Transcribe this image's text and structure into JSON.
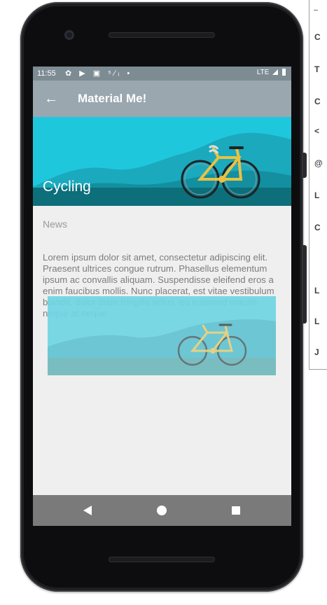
{
  "status_bar": {
    "time": "11:55",
    "icons": "✿ ▶ ▣ ⁵⁄ᵢ •",
    "network": "LTE"
  },
  "app_bar": {
    "back_icon": "←",
    "title": "Material Me!"
  },
  "detail": {
    "image_title": "Cycling",
    "subtitle": "News",
    "body": "Lorem ipsum dolor sit amet, consectetur adipiscing elit. Praesent ultrices congue rutrum. Phasellus elementum ipsum ac convallis aliquam. Suspendisse eleifend eros a enim faucibus mollis. Nunc placerat, est vitae vestibulum blandit, dolor diam fringilla tellus, eu euismod mauris neque at neque."
  },
  "nav_bar": {
    "back_icon": "back-triangle-icon",
    "home_icon": "home-circle-icon",
    "recent_icon": "recent-square-icon"
  },
  "editor_fragment": {
    "glyphs": [
      "C",
      "T",
      "C",
      "<",
      "@",
      "L",
      "C",
      "L",
      "L",
      "J"
    ]
  },
  "colors": {
    "status_bar": "#7d8b93",
    "app_bar": "#9aa7ae",
    "sky": "#1fc7dd",
    "screen_bg": "#efefef",
    "nav_bar": "#7a7a7a"
  }
}
